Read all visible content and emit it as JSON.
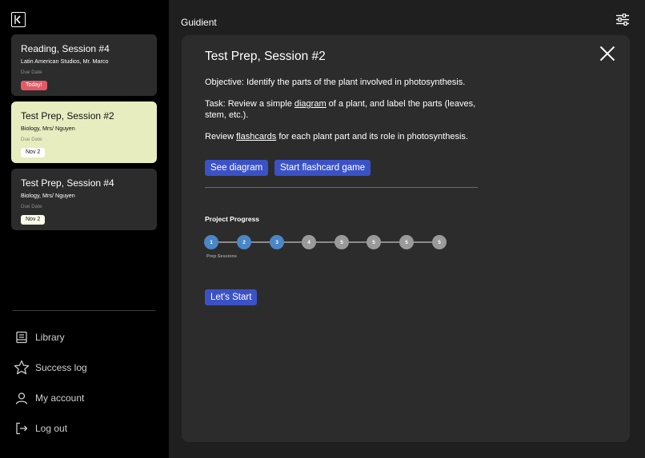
{
  "app": {
    "name": "Guidient"
  },
  "sidebar": {
    "cards": [
      {
        "title": "Reading, Session #4",
        "subtitle": "Latin American Studios, Mr. Marco",
        "due_label": "Due Date",
        "due": "Today!"
      },
      {
        "title": "Test Prep, Session #2",
        "subtitle": "Biology, Mrs/ Nguyen",
        "due_label": "Due Date",
        "due": "Nov 2"
      },
      {
        "title": "Test Prep, Session #4",
        "subtitle": "Biology, Mrs/ Nguyen",
        "due_label": "Due Date",
        "due": "Nov 2"
      }
    ],
    "nav": [
      {
        "label": "Library",
        "icon": "book-icon"
      },
      {
        "label": "Success log",
        "icon": "star-icon"
      },
      {
        "label": "My account",
        "icon": "user-icon"
      },
      {
        "label": "Log out",
        "icon": "logout-icon"
      }
    ]
  },
  "panel": {
    "title": "Test Prep, Session #2",
    "objective": "Objective: Identify the parts of the plant involved in photosynthesis.",
    "task_prefix": "Task: Review a simple ",
    "task_link": "diagram",
    "task_suffix": " of a plant, and label the parts (leaves, stem, etc.).",
    "review_prefix": "Review ",
    "review_link": "flashcards",
    "review_suffix": " for each plant part and its role in photosynthesis.",
    "buttons": {
      "see_diagram": "See diagram",
      "flashcard_game": "Start flashcard game",
      "lets_start": "Let's Start"
    },
    "progress": {
      "title": "Project Progress",
      "caption": "Prep Sessions",
      "steps": [
        "1",
        "2",
        "3",
        "4",
        "5",
        "5",
        "5",
        "5"
      ],
      "completed": 3
    }
  },
  "colors": {
    "accent": "#3b52c7",
    "active_card": "#e7edbf",
    "badge_today": "#e35a66",
    "step_done": "#4b86c6",
    "step_pending": "#9a9a9a"
  }
}
